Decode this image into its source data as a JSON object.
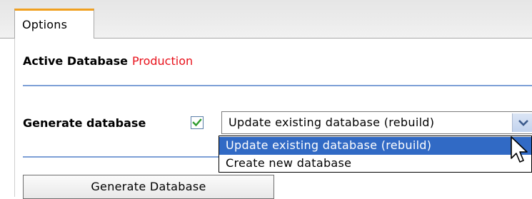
{
  "tabs": [
    {
      "label": "Options",
      "active": true
    }
  ],
  "active_database": {
    "label": "Active Database",
    "value": "Production",
    "value_color": "#e8101a"
  },
  "generate": {
    "label": "Generate database",
    "checkbox_checked": true,
    "select_value": "Update existing database (rebuild)",
    "options": [
      "Update existing database (rebuild)",
      "Create new database"
    ],
    "highlighted_option": 0
  },
  "button": {
    "label": "Generate Database"
  },
  "colors": {
    "accent_tab": "#f0a020",
    "separator": "#7d9fd6",
    "selection": "#316ac5",
    "check": "#2e9b2e"
  }
}
